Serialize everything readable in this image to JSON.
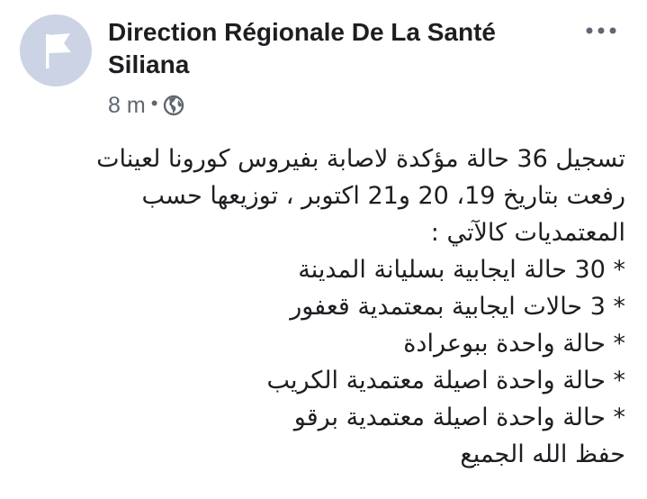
{
  "post": {
    "author": "Direction Régionale De La Santé Siliana",
    "timestamp": "8 m",
    "separator": "•",
    "audience_icon": "globe-icon",
    "more_icon": "more-horizontal-icon",
    "text": {
      "intro": "تسجيل 36 حالة مؤكدة لاصابة بفيروس كورونا  لعينات رفعت بتاريخ 19، 20 و21 اكتوبر ، توزيعها حسب المعتمديات كالآتي :",
      "lines": [
        "* 30 حالة ايجابية بسليانة المدينة",
        "* 3 حالات ايجابية بمعتمدية قعفور",
        "* حالة واحدة ببوعرادة",
        "* حالة واحدة اصيلة معتمدية الكريب",
        "* حالة واحدة اصيلة معتمدية برقو"
      ],
      "closing": "حفظ الله الجميع"
    }
  },
  "colors": {
    "avatar_bg": "#ccd3e5",
    "text": "#1c1e21",
    "meta": "#606770"
  }
}
